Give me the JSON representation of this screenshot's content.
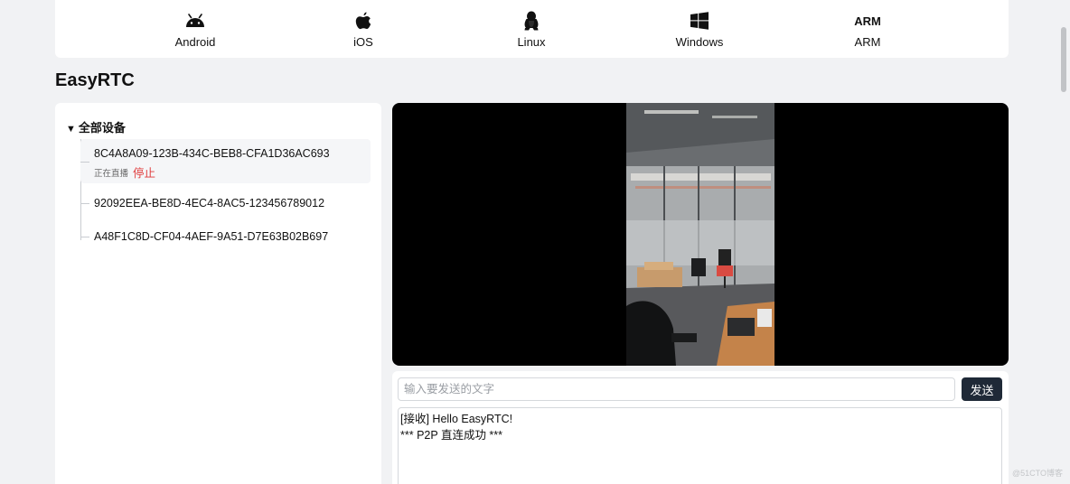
{
  "platforms": [
    {
      "label": "Android",
      "icon": "android-icon"
    },
    {
      "label": "iOS",
      "icon": "apple-icon"
    },
    {
      "label": "Linux",
      "icon": "linux-penguin-icon"
    },
    {
      "label": "Windows",
      "icon": "windows-icon"
    },
    {
      "label": "ARM",
      "icon": "arm-logo",
      "icon_text": "ARM"
    }
  ],
  "page_title": "EasyRTC",
  "device_tree": {
    "root_label": "全部设备",
    "devices": [
      {
        "id": "8C4A8A09-123B-434C-BEB8-CFA1D36AC693",
        "status": "正在直播",
        "action": "停止",
        "active": true
      },
      {
        "id": "92092EEA-BE8D-4EC4-8AC5-123456789012"
      },
      {
        "id": "A48F1C8D-CF04-4AEF-9A51-D7E63B02B697"
      }
    ]
  },
  "chat": {
    "input_placeholder": "输入要发送的文字",
    "input_value": "",
    "send_label": "发送",
    "log_lines": [
      "[接收] Hello EasyRTC!",
      "*** P2P 直连成功 ***"
    ]
  },
  "watermark": "@51CTO博客",
  "colors": {
    "accent": "#1f2937",
    "stop": "#e03a3a",
    "page_bg": "#f1f2f4"
  }
}
